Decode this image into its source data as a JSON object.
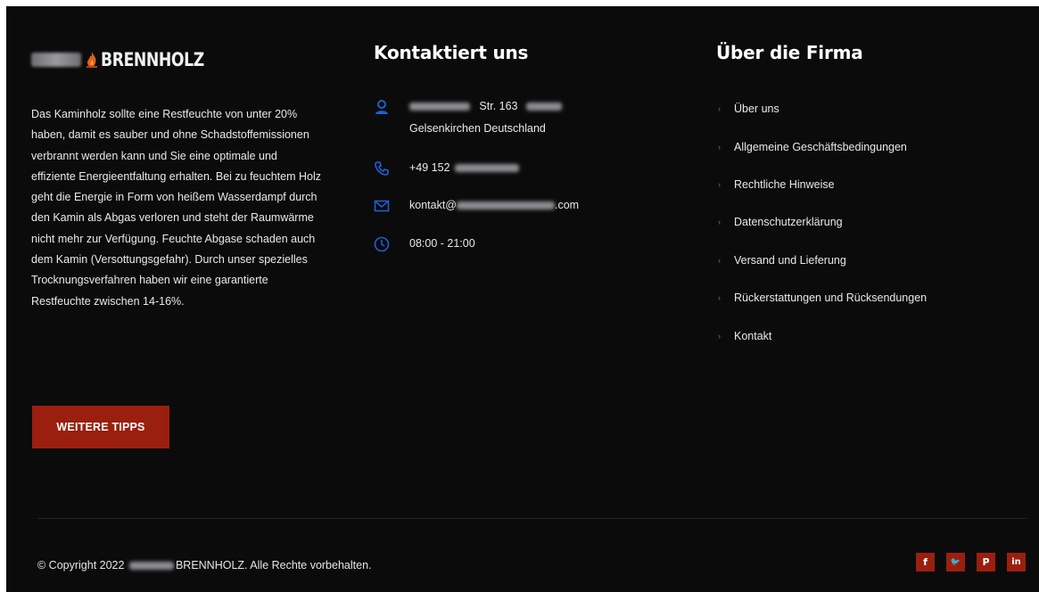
{
  "brand": {
    "name": "BRENNHOLZ"
  },
  "about": {
    "text": "Das Kaminholz sollte eine Restfeuchte von unter 20% haben, damit es sauber und ohne Schadstoffemissionen verbrannt werden kann und Sie eine optimale und effiziente Energieentfaltung erhalten. Bei zu feuchtem Holz geht die Energie in Form von heißem Wasserdampf durch den Kamin als Abgas verloren und steht der Raumwärme nicht mehr zur Verfügung. Feuchte Abgase schaden auch dem Kamin (Versottungsgefahr). Durch unser spezielles Trocknungsverfahren haben wir eine garantierte Restfeuchte zwischen 14-16%.",
    "button_label": "WEITERE TIPPS"
  },
  "contact": {
    "heading": "Kontaktiert uns",
    "address_street": "Str. 163",
    "address_city": "Gelsenkirchen Deutschland",
    "phone": "+49 152",
    "email_prefix": "kontakt@",
    "email_suffix": ".com",
    "hours": "08:00 - 21:00",
    "icons": [
      "user-icon",
      "phone-icon",
      "envelope-icon",
      "clock-icon"
    ],
    "icon_color": "#1f5fd1"
  },
  "company": {
    "heading": "Über die Firma",
    "links": [
      "Über uns",
      "Allgemeine Geschäftsbedingungen",
      "Rechtliche Hinweise",
      "Datenschutzerklärung",
      "Versand und Lieferung",
      "Rückerstattungen und Rücksendungen",
      "Kontakt"
    ]
  },
  "footer": {
    "copyright_prefix": "© Copyright 2022",
    "copyright_suffix": "BRENNHOLZ. Alle Rechte vorbehalten.",
    "socials": [
      {
        "name": "facebook-icon",
        "glyph": "f"
      },
      {
        "name": "twitter-icon",
        "glyph": "🐦"
      },
      {
        "name": "pinterest-icon",
        "glyph": "P"
      },
      {
        "name": "linkedin-icon",
        "glyph": "in"
      }
    ],
    "accent_color": "#9a1f0e",
    "background_color": "#0b0b0c"
  }
}
